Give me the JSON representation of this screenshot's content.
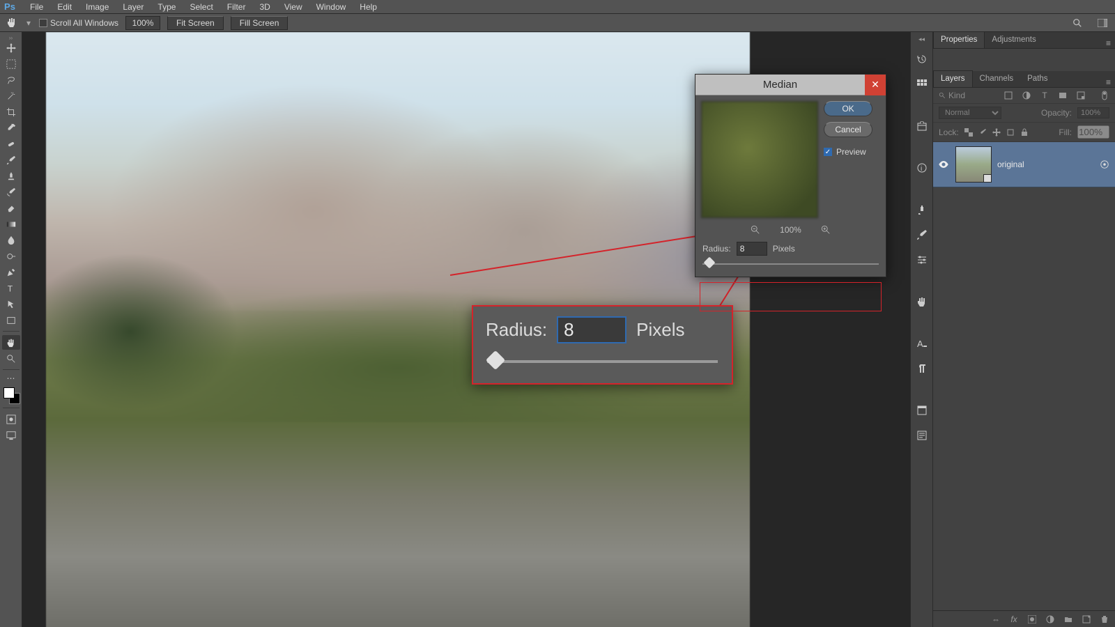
{
  "app": {
    "logo": "Ps"
  },
  "menu": [
    "File",
    "Edit",
    "Image",
    "Layer",
    "Type",
    "Select",
    "Filter",
    "3D",
    "View",
    "Window",
    "Help"
  ],
  "options": {
    "scroll_all_label": "Scroll All Windows",
    "zoom_value": "100%",
    "fit_screen": "Fit Screen",
    "fill_screen": "Fill Screen"
  },
  "tools": [
    "move",
    "rect-marquee",
    "lasso",
    "magic-wand",
    "crop",
    "eyedropper",
    "spot-heal",
    "brush",
    "clone-stamp",
    "history-brush",
    "eraser",
    "gradient",
    "blur",
    "dodge",
    "pen",
    "type",
    "path-select",
    "rectangle",
    "hand",
    "zoom"
  ],
  "active_tool": "hand",
  "panels": {
    "top_tabs": [
      "Properties",
      "Adjustments"
    ],
    "top_active": "Properties",
    "bottom_tabs": [
      "Layers",
      "Channels",
      "Paths"
    ],
    "bottom_active": "Layers"
  },
  "layers": {
    "kind_placeholder": "Kind",
    "filter_icons": [
      "image",
      "adjust",
      "type",
      "shape",
      "smart"
    ],
    "blend_mode": "Normal",
    "opacity_label": "Opacity:",
    "opacity_value": "100%",
    "lock_label": "Lock:",
    "lock_icons": [
      "transparent",
      "image",
      "position",
      "artboard",
      "all"
    ],
    "fill_label": "Fill:",
    "fill_value": "100%",
    "items": [
      {
        "name": "original",
        "visible": true,
        "smart": true
      }
    ],
    "footer_icons": [
      "link",
      "fx",
      "mask",
      "adjustment",
      "group",
      "new",
      "trash"
    ]
  },
  "dialog": {
    "title": "Median",
    "ok": "OK",
    "cancel": "Cancel",
    "preview_label": "Preview",
    "preview_checked": true,
    "zoom_pct": "100%",
    "radius_label": "Radius:",
    "radius_value": "8",
    "radius_unit": "Pixels"
  },
  "callout": {
    "radius_label": "Radius:",
    "radius_value": "8",
    "radius_unit": "Pixels"
  },
  "icon_strip": [
    "history",
    "color",
    "swatches",
    "libraries",
    "info",
    "brush-presets",
    "clone-source",
    "actions",
    "glyphs",
    "paragraph",
    "properties",
    "notes"
  ]
}
